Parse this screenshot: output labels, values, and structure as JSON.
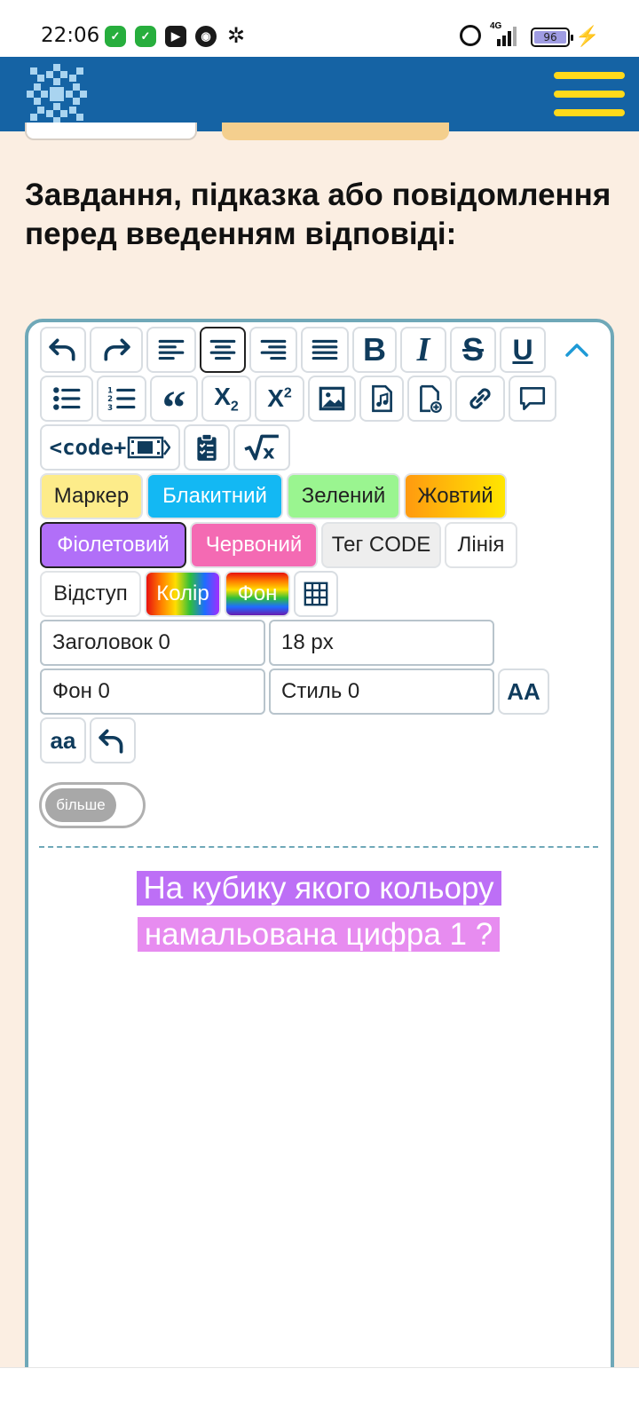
{
  "status_bar": {
    "time": "22:06",
    "network": "4G",
    "battery": "96"
  },
  "header": {
    "logo_icon": "snowflake-ornament-icon",
    "menu_icon": "hamburger-menu-icon"
  },
  "title": "Завдання, підказка або повідомлення перед введенням відповіді:",
  "toolbar": {
    "color_chips": {
      "marker": "Маркер",
      "blue": "Блакитний",
      "green": "Зелений",
      "yellow": "Жовтий",
      "violet": "Фіолетовий",
      "red": "Червоний",
      "code_tag": "Тег CODE",
      "line": "Лінія",
      "indent": "Відступ",
      "color": "Колір",
      "bg": "Фон"
    },
    "code_label": "<code+",
    "heading_field": "Заголовок 0",
    "size_field": "18 px",
    "bg_field": "Фон 0",
    "style_field": "Стиль 0",
    "uppercase_btn": "AA",
    "lowercase_btn": "aa",
    "more_toggle": "більше"
  },
  "content": {
    "line1": "На кубику якого кольору",
    "line2": "намальована цифра 1 ?"
  },
  "colors": {
    "header": "#1563a4",
    "accent_yellow": "#ffd91a",
    "editor_border": "#6fa8b8",
    "violet_highlight": "#bd6ff6"
  }
}
